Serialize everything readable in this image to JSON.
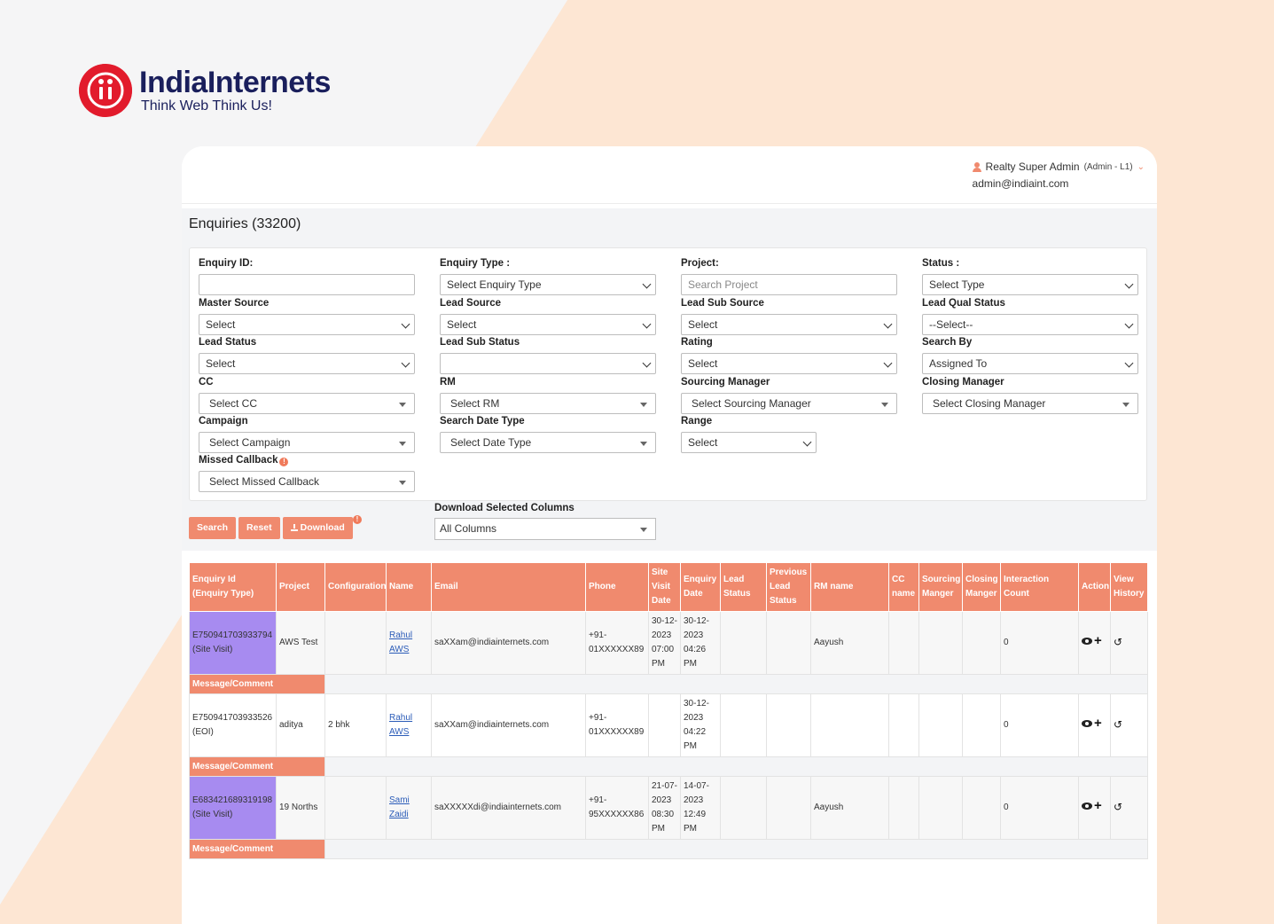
{
  "brand": {
    "name": "IndiaInternets",
    "tagline": "Think Web Think Us!"
  },
  "user": {
    "name": "Realty Super Admin",
    "role": "(Admin - L1)",
    "email": "admin@indiaint.com"
  },
  "page_title": "Enquiries (33200)",
  "filters": {
    "enquiry_id": {
      "label": "Enquiry ID:",
      "value": ""
    },
    "enquiry_type": {
      "label": "Enquiry Type :",
      "value": "Select Enquiry Type"
    },
    "project": {
      "label": "Project:",
      "placeholder": "Search Project"
    },
    "status": {
      "label": "Status :",
      "value": "Select Type"
    },
    "master_source": {
      "label": "Master Source",
      "value": "Select"
    },
    "lead_source": {
      "label": "Lead Source",
      "value": "Select"
    },
    "lead_sub_source": {
      "label": "Lead Sub Source",
      "value": "Select"
    },
    "lead_qual_status": {
      "label": "Lead Qual Status",
      "value": "--Select--"
    },
    "lead_status": {
      "label": "Lead Status",
      "value": "Select"
    },
    "lead_sub_status": {
      "label": "Lead Sub Status",
      "value": ""
    },
    "rating": {
      "label": "Rating",
      "value": "Select"
    },
    "search_by": {
      "label": "Search By",
      "value": "Assigned To"
    },
    "cc": {
      "label": "CC",
      "value": "Select CC"
    },
    "rm": {
      "label": "RM",
      "value": "Select RM"
    },
    "sourcing_manager": {
      "label": "Sourcing Manager",
      "value": "Select Sourcing Manager"
    },
    "closing_manager": {
      "label": "Closing Manager",
      "value": "Select Closing Manager"
    },
    "campaign": {
      "label": "Campaign",
      "value": "Select Campaign"
    },
    "search_date_type": {
      "label": "Search Date Type",
      "value": "Select Date Type"
    },
    "range": {
      "label": "Range",
      "value": "Select"
    },
    "missed_callback": {
      "label": "Missed Callback",
      "value": "Select Missed Callback"
    }
  },
  "buttons": {
    "search": "Search",
    "reset": "Reset",
    "download": "Download"
  },
  "download_columns": {
    "label": "Download Selected Columns",
    "value": "All Columns"
  },
  "table": {
    "headers": [
      "Enquiry Id (Enquiry Type)",
      "Project",
      "Configuration",
      "Name",
      "Email",
      "Phone",
      "Site Visit Date",
      "Enquiry Date",
      "Lead Status",
      "Previous Lead Status",
      "RM name",
      "CC name",
      "Sourcing Manger",
      "Closing Manger",
      "Interaction Count",
      "Action",
      "View History"
    ],
    "message_label": "Message/Comment",
    "rows": [
      {
        "id": "E750941703933794",
        "type": "(Site Visit)",
        "project": "AWS Test",
        "config": "",
        "name_1": "Rahul",
        "name_2": "AWS",
        "email": "saXXam@indiainternets.com",
        "phone_1": "+91-",
        "phone_2": "01XXXXXX89",
        "site_visit": [
          "30-12-",
          "2023",
          "07:00",
          "PM"
        ],
        "enquiry_date": [
          "30-12-",
          "2023",
          "04:26",
          "PM"
        ],
        "lead_status": "",
        "prev_status": "",
        "rm": "Aayush",
        "cc": "",
        "sourcing": "",
        "closing": "",
        "interactions": "0"
      },
      {
        "id": "E750941703933526",
        "type": "(EOI)",
        "project": "aditya",
        "config": "2 bhk",
        "name_1": "Rahul",
        "name_2": "AWS",
        "email": "saXXam@indiainternets.com",
        "phone_1": "+91-",
        "phone_2": "01XXXXXX89",
        "site_visit": [
          "",
          "",
          "",
          ""
        ],
        "enquiry_date": [
          "30-12-",
          "2023",
          "04:22",
          "PM"
        ],
        "lead_status": "",
        "prev_status": "",
        "rm": "",
        "cc": "",
        "sourcing": "",
        "closing": "",
        "interactions": "0"
      },
      {
        "id": "E683421689319198",
        "type": "(Site Visit)",
        "project": "19 Norths",
        "config": "",
        "name_1": "Sami",
        "name_2": "Zaidi",
        "email": "saXXXXXdi@indiainternets.com",
        "phone_1": "+91-",
        "phone_2": "95XXXXXX86",
        "site_visit": [
          "21-07-",
          "2023",
          "08:30",
          "PM"
        ],
        "enquiry_date": [
          "14-07-",
          "2023",
          "12:49",
          "PM"
        ],
        "lead_status": "",
        "prev_status": "",
        "rm": "Aayush",
        "cc": "",
        "sourcing": "",
        "closing": "",
        "interactions": "0"
      }
    ]
  },
  "colors": {
    "accent": "#f08a6e",
    "purple": "#a78bf0",
    "brand_red": "#e21b2c",
    "brand_navy": "#1a1f5c",
    "peach_bg": "#fde6d3"
  }
}
